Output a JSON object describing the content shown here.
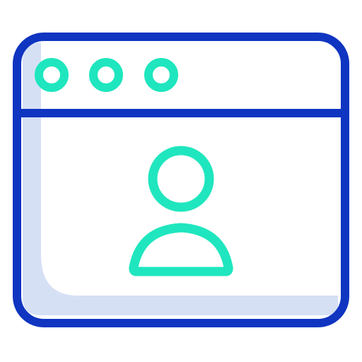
{
  "icon": {
    "name": "browser-user-profile-icon",
    "colors": {
      "frame": "#0F35C1",
      "accent": "#1FE6BE",
      "shadow": "#D6E0F5",
      "background": "#FFFFFF"
    },
    "window_dots_count": 3
  }
}
